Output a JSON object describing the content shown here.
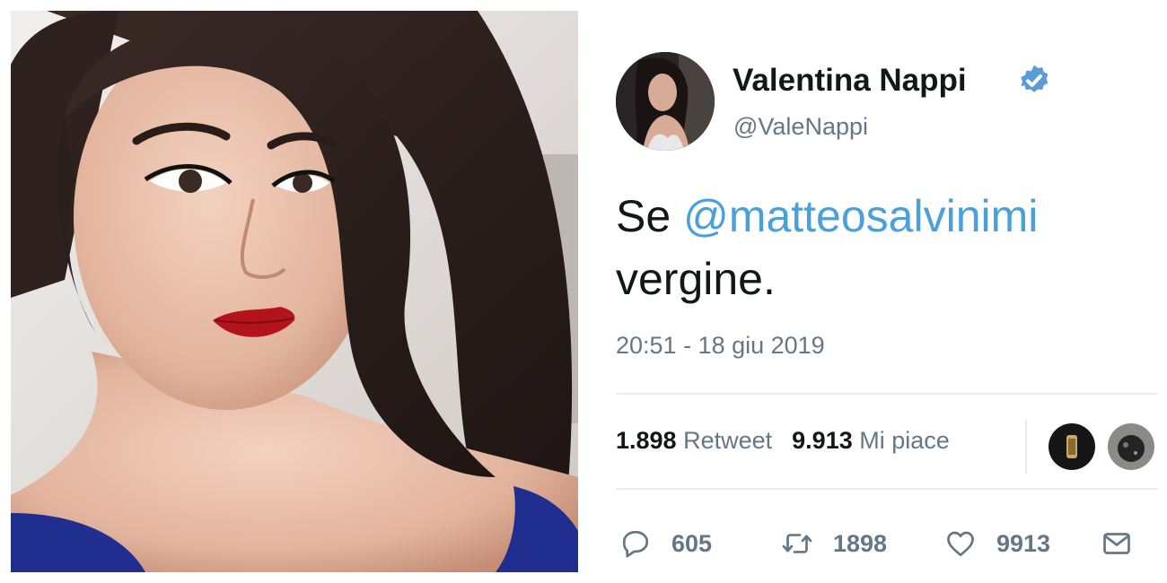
{
  "tweet": {
    "author_name": "Valentina Nappi",
    "handle": "@ValeNappi",
    "text_prefix": "Se ",
    "mention": "@matteosalvinimi",
    "text_suffix": "vergine.",
    "timestamp": "20:51 - 18 giu 2019",
    "retweets_count": "1.898",
    "retweets_label": "Retweet",
    "likes_count": "9.913",
    "likes_label": "Mi piace"
  },
  "actions": {
    "reply_count": "605",
    "retweet_count": "1898",
    "like_count": "9913"
  },
  "icons": {
    "verified": "verified-badge-icon",
    "reply": "reply-icon",
    "retweet": "retweet-icon",
    "like": "heart-icon",
    "message": "envelope-icon"
  },
  "colors": {
    "mention": "#4aa0d9",
    "verified": "#1da1f2",
    "secondary_text": "#657786",
    "primary_text": "#14171a"
  }
}
